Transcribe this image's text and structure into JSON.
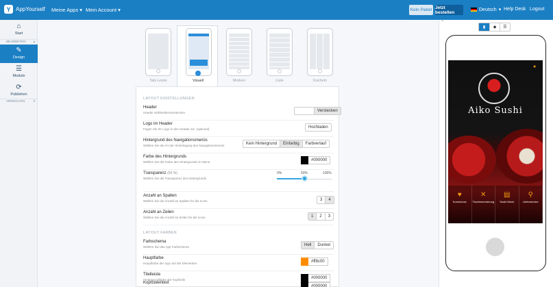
{
  "topbar": {
    "app_name": "AppYourself",
    "nav": [
      "Meine Apps",
      "Mein Account"
    ],
    "plan_btn": "Kein Paket",
    "buy_btn": "Jetzt bestellen",
    "language": "Deutsch",
    "help": "Help Desk",
    "logout": "Logout"
  },
  "sidebar": {
    "items": [
      {
        "label": "Start",
        "icon": "home-icon"
      },
      {
        "label": "Design",
        "icon": "edit-icon"
      },
      {
        "label": "Module",
        "icon": "menu-icon"
      },
      {
        "label": "Publishen",
        "icon": "refresh-icon"
      }
    ],
    "sections": [
      "BEARBEITEN",
      "VERWALTEN"
    ]
  },
  "layouts": [
    {
      "label": "Tab-Leiste"
    },
    {
      "label": "Visuell"
    },
    {
      "label": "Modern"
    },
    {
      "label": "Liste"
    },
    {
      "label": "Kacheln"
    }
  ],
  "settings": {
    "section_layout": "LAYOUT EINSTELLUNGEN",
    "header": {
      "title": "Header",
      "desc": "Header einblenden/verstecken",
      "options": [
        "",
        "Verstecken"
      ]
    },
    "logo": {
      "title": "Logo im Header",
      "desc": "Fügen Sie Ihr Logo in den Header ein. (optional)",
      "button": "Hochladen"
    },
    "nav_bg": {
      "title": "Hintergrund des Navigationsmenüs",
      "desc": "Wählen Sie die Art der Hinterlegung des Navigationsmenüs",
      "options": [
        "Kein Hintergrund",
        "Einfarbig",
        "Farbverlauf"
      ]
    },
    "bg_color": {
      "title": "Farbe des Hintergrunds",
      "desc": "Wählen Sie die Farbe des Hintergrunds im Menü",
      "value": "#000000",
      "swatch": "#000000"
    },
    "transparency": {
      "title": "Transparenz",
      "title_suffix": "(50 %)",
      "desc": "Wählen Sie die Transparenz des Hintergrunds",
      "labels": [
        "0%",
        "50%",
        "100%"
      ],
      "value": 0.5
    },
    "columns": {
      "title": "Anzahl an Spalten",
      "desc": "Wählen Sie die Anzahl an Spalten für die Icons",
      "options": [
        "3",
        "4"
      ]
    },
    "rows": {
      "title": "Anzahl an Zeilen",
      "desc": "Wählen Sie die Anzahl an Zeilen für die Icons",
      "options": [
        "1",
        "2",
        "3"
      ]
    },
    "section_colors": "LAYOUT FARBEN",
    "scheme": {
      "title": "Farbschema",
      "desc": "Wählen Sie das App Farbschema",
      "options": [
        "Hell",
        "Dunkel"
      ]
    },
    "main_color": {
      "title": "Hauptfarbe",
      "desc": "Hauptfarbe der App und der Elementen",
      "value": "#ff8c00",
      "swatch": "#ff8c00"
    },
    "title_bar": {
      "title": "Titelleiste",
      "desc": "Hintergrundfarbe der Kopfzeile",
      "value": "#000000",
      "swatch": "#000000"
    },
    "header_text": {
      "title": "Kopfzeilentext",
      "value": "#000000",
      "swatch": "#000000"
    }
  },
  "preview": {
    "app_title": "Aiko Sushi",
    "tiles": [
      "Koreschow",
      "Tischreservierung",
      "Sushi Menü",
      "Lieferservice"
    ]
  }
}
